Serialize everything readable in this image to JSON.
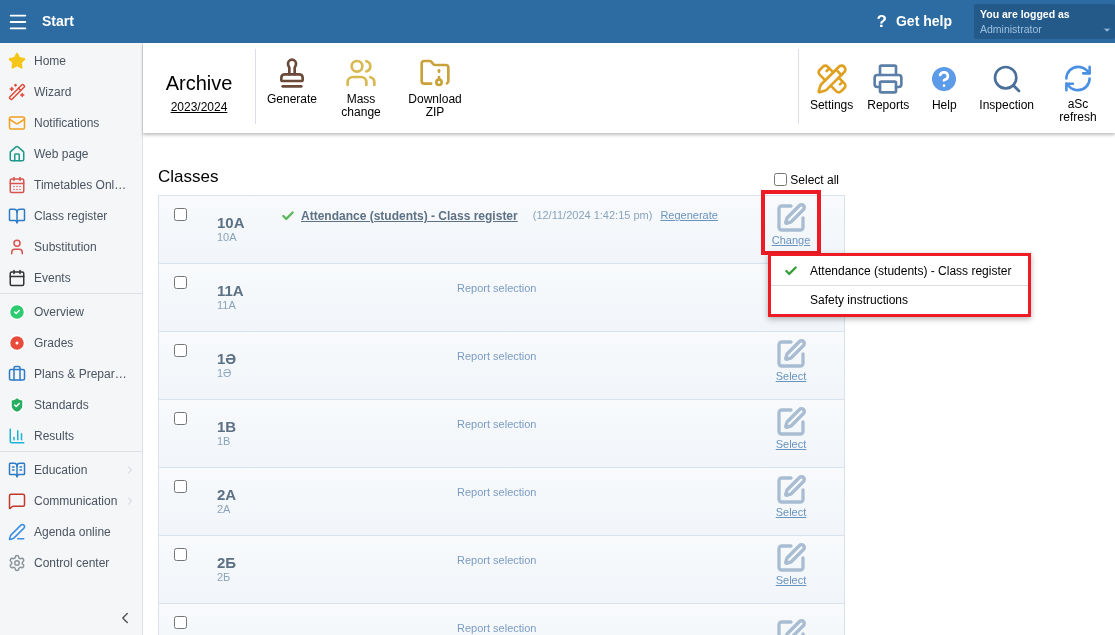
{
  "header": {
    "menu_label": "Start",
    "help_icon": "?",
    "help": "Get help",
    "user": {
      "caption": "You are logged as",
      "name": "Administrator"
    }
  },
  "sidebar": {
    "groups": [
      [
        {
          "label": "Home",
          "submenu": false
        },
        {
          "label": "Wizard",
          "submenu": false
        },
        {
          "label": "Notifications",
          "submenu": false
        },
        {
          "label": "Web page",
          "submenu": false
        },
        {
          "label": "Timetables Onl…",
          "submenu": false
        },
        {
          "label": "Class register",
          "submenu": false
        },
        {
          "label": "Substitution",
          "submenu": false
        },
        {
          "label": "Events",
          "submenu": false
        }
      ],
      [
        {
          "label": "Overview",
          "submenu": false
        },
        {
          "label": "Grades",
          "submenu": false
        },
        {
          "label": "Plans & Prepar…",
          "submenu": false
        },
        {
          "label": "Standards",
          "submenu": false
        },
        {
          "label": "Results",
          "submenu": false
        }
      ],
      [
        {
          "label": "Education",
          "submenu": true
        },
        {
          "label": "Communication",
          "submenu": true
        },
        {
          "label": "Agenda online",
          "submenu": false
        },
        {
          "label": "Control center",
          "submenu": false
        }
      ]
    ]
  },
  "toolbar": {
    "archive": {
      "title": "Archive",
      "year": "2023/2024"
    },
    "left_tools": [
      "Generate",
      "Mass change",
      "Download ZIP"
    ],
    "right_tools": [
      "Settings",
      "Reports",
      "Help",
      "Inspection",
      "aSc refresh"
    ]
  },
  "classes": {
    "title": "Classes",
    "select_all": {
      "label": "Select all",
      "checked": false
    },
    "rows": [
      {
        "kind": "generated",
        "checked": false,
        "name": "10A",
        "code": "10A",
        "report": "Attendance (students) - Class register",
        "timestamp": "(12/11/2024 1:42:15 pm)",
        "regenerate": "Regenerate",
        "action": "Change",
        "highlighted": true
      },
      {
        "kind": "pending",
        "checked": false,
        "name": "11A",
        "code": "11A",
        "report": "Report selection",
        "highlighted": false
      },
      {
        "kind": "pending",
        "checked": false,
        "name": "1Ə",
        "code": "1Ə",
        "report": "Report selection",
        "action": "Select",
        "highlighted": false
      },
      {
        "kind": "pending",
        "checked": false,
        "name": "1B",
        "code": "1B",
        "report": "Report selection",
        "action": "Select",
        "highlighted": false
      },
      {
        "kind": "pending",
        "checked": false,
        "name": "2A",
        "code": "2A",
        "report": "Report selection",
        "action": "Select",
        "highlighted": false
      },
      {
        "kind": "pending",
        "checked": false,
        "name": "2Б",
        "code": "2Б",
        "report": "Report selection",
        "action": "Select",
        "highlighted": false
      },
      {
        "kind": "pending",
        "checked": false,
        "report": "Report selection",
        "highlighted": false
      }
    ]
  },
  "dropdown": {
    "highlighted": true,
    "items": [
      {
        "label": "Attendance (students) - Class register",
        "selected": true
      },
      {
        "label": "Safety instructions",
        "selected": false
      }
    ]
  }
}
